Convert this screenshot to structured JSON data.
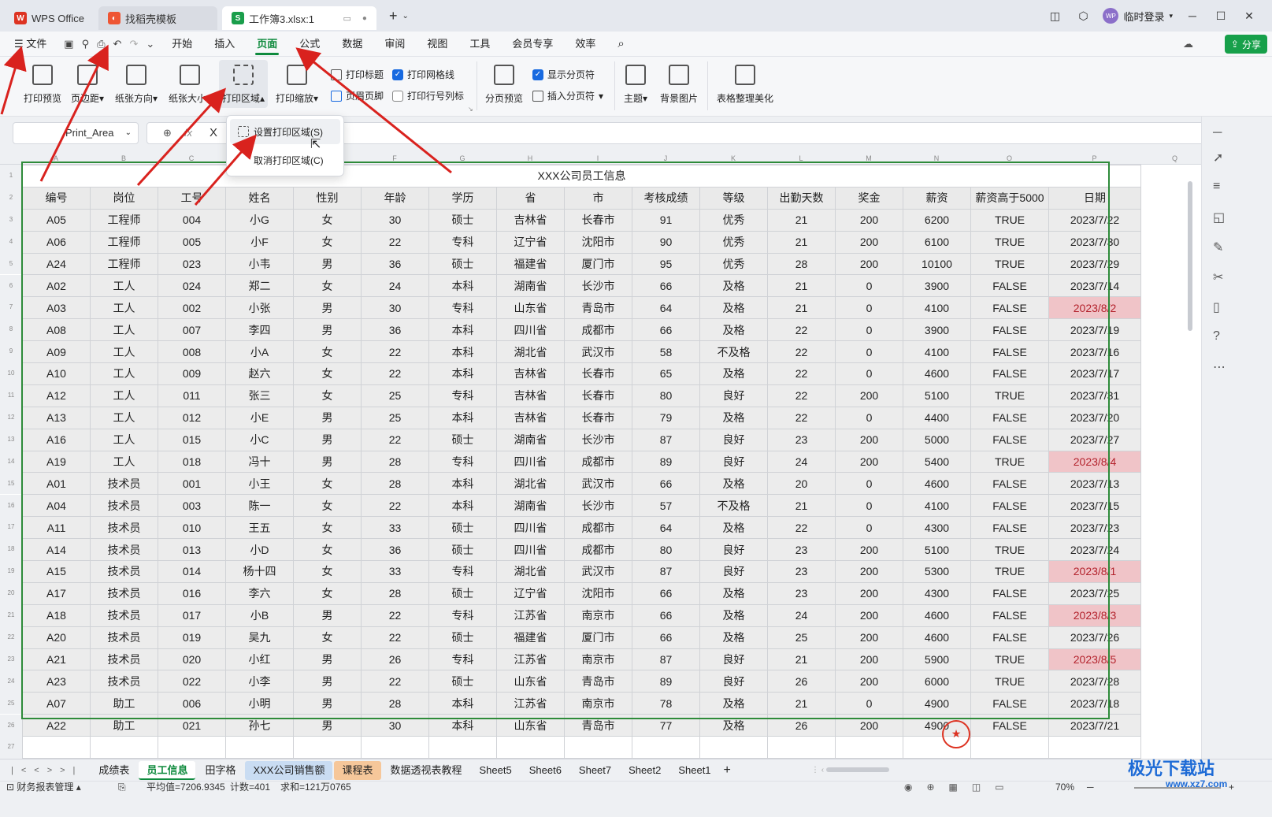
{
  "titlebar": {
    "tabs": [
      {
        "label": "WPS Office",
        "icon": "wps-logo-icon"
      },
      {
        "label": "找稻壳模板",
        "icon": "docer-icon"
      },
      {
        "label": "工作簿3.xlsx:1",
        "icon": "sheet-icon"
      }
    ],
    "user": "临时登录"
  },
  "menubar": {
    "file": "文件",
    "items": [
      "开始",
      "插入",
      "页面",
      "公式",
      "数据",
      "审阅",
      "视图",
      "工具",
      "会员专享",
      "效率"
    ],
    "active": "页面",
    "share": "分享"
  },
  "ribbon": {
    "print_preview": "打印预览",
    "margins": "页边距",
    "orientation": "纸张方向",
    "paper_size": "纸张大小",
    "print_area": "打印区域",
    "print_scale": "打印缩放",
    "print_titles": "打印标题",
    "header_footer": "页眉页脚",
    "print_gridlines": "打印网格线",
    "print_row_col": "打印行号列标",
    "page_break_preview": "分页预览",
    "show_page_breaks": "显示分页符",
    "insert_page_break": "插入分页符",
    "theme": "主题",
    "background": "背景图片",
    "beautify": "表格整理美化"
  },
  "formula": {
    "namebox": "Print_Area",
    "fx": "fx",
    "content": "X"
  },
  "dropdown": {
    "set": "设置打印区域(S)",
    "cancel": "取消打印区域(C)"
  },
  "columns": [
    "A",
    "B",
    "C",
    "D",
    "E",
    "F",
    "G",
    "H",
    "I",
    "J",
    "K",
    "L",
    "M",
    "N",
    "O",
    "P",
    "Q"
  ],
  "sheet": {
    "title": "XXX公司员工信息",
    "headers": [
      "编号",
      "岗位",
      "工号",
      "姓名",
      "性别",
      "年龄",
      "学历",
      "省",
      "市",
      "考核成绩",
      "等级",
      "出勤天数",
      "奖金",
      "薪资",
      "薪资高于5000",
      "日期"
    ],
    "rows": [
      [
        "A05",
        "工程师",
        "004",
        "小G",
        "女",
        "30",
        "硕士",
        "吉林省",
        "长春市",
        "91",
        "优秀",
        "21",
        "200",
        "6200",
        "TRUE",
        "2023/7/22"
      ],
      [
        "A06",
        "工程师",
        "005",
        "小F",
        "女",
        "22",
        "专科",
        "辽宁省",
        "沈阳市",
        "90",
        "优秀",
        "21",
        "200",
        "6100",
        "TRUE",
        "2023/7/30"
      ],
      [
        "A24",
        "工程师",
        "023",
        "小韦",
        "男",
        "36",
        "硕士",
        "福建省",
        "厦门市",
        "95",
        "优秀",
        "28",
        "200",
        "10100",
        "TRUE",
        "2023/7/29"
      ],
      [
        "A02",
        "工人",
        "024",
        "郑二",
        "女",
        "24",
        "本科",
        "湖南省",
        "长沙市",
        "66",
        "及格",
        "21",
        "0",
        "3900",
        "FALSE",
        "2023/7/14"
      ],
      [
        "A03",
        "工人",
        "002",
        "小张",
        "男",
        "30",
        "专科",
        "山东省",
        "青岛市",
        "64",
        "及格",
        "21",
        "0",
        "4100",
        "FALSE",
        "2023/8/2"
      ],
      [
        "A08",
        "工人",
        "007",
        "李四",
        "男",
        "36",
        "本科",
        "四川省",
        "成都市",
        "66",
        "及格",
        "22",
        "0",
        "3900",
        "FALSE",
        "2023/7/19"
      ],
      [
        "A09",
        "工人",
        "008",
        "小A",
        "女",
        "22",
        "本科",
        "湖北省",
        "武汉市",
        "58",
        "不及格",
        "22",
        "0",
        "4100",
        "FALSE",
        "2023/7/16"
      ],
      [
        "A10",
        "工人",
        "009",
        "赵六",
        "女",
        "22",
        "本科",
        "吉林省",
        "长春市",
        "65",
        "及格",
        "22",
        "0",
        "4600",
        "FALSE",
        "2023/7/17"
      ],
      [
        "A12",
        "工人",
        "011",
        "张三",
        "女",
        "25",
        "专科",
        "吉林省",
        "长春市",
        "80",
        "良好",
        "22",
        "200",
        "5100",
        "TRUE",
        "2023/7/31"
      ],
      [
        "A13",
        "工人",
        "012",
        "小E",
        "男",
        "25",
        "本科",
        "吉林省",
        "长春市",
        "79",
        "及格",
        "22",
        "0",
        "4400",
        "FALSE",
        "2023/7/20"
      ],
      [
        "A16",
        "工人",
        "015",
        "小C",
        "男",
        "22",
        "硕士",
        "湖南省",
        "长沙市",
        "87",
        "良好",
        "23",
        "200",
        "5000",
        "FALSE",
        "2023/7/27"
      ],
      [
        "A19",
        "工人",
        "018",
        "冯十",
        "男",
        "28",
        "专科",
        "四川省",
        "成都市",
        "89",
        "良好",
        "24",
        "200",
        "5400",
        "TRUE",
        "2023/8/4"
      ],
      [
        "A01",
        "技术员",
        "001",
        "小王",
        "女",
        "28",
        "本科",
        "湖北省",
        "武汉市",
        "66",
        "及格",
        "20",
        "0",
        "4600",
        "FALSE",
        "2023/7/13"
      ],
      [
        "A04",
        "技术员",
        "003",
        "陈一",
        "女",
        "22",
        "本科",
        "湖南省",
        "长沙市",
        "57",
        "不及格",
        "21",
        "0",
        "4100",
        "FALSE",
        "2023/7/15"
      ],
      [
        "A11",
        "技术员",
        "010",
        "王五",
        "女",
        "33",
        "硕士",
        "四川省",
        "成都市",
        "64",
        "及格",
        "22",
        "0",
        "4300",
        "FALSE",
        "2023/7/23"
      ],
      [
        "A14",
        "技术员",
        "013",
        "小D",
        "女",
        "36",
        "硕士",
        "四川省",
        "成都市",
        "80",
        "良好",
        "23",
        "200",
        "5100",
        "TRUE",
        "2023/7/24"
      ],
      [
        "A15",
        "技术员",
        "014",
        "杨十四",
        "女",
        "33",
        "专科",
        "湖北省",
        "武汉市",
        "87",
        "良好",
        "23",
        "200",
        "5300",
        "TRUE",
        "2023/8/1"
      ],
      [
        "A17",
        "技术员",
        "016",
        "李六",
        "女",
        "28",
        "硕士",
        "辽宁省",
        "沈阳市",
        "66",
        "及格",
        "23",
        "200",
        "4300",
        "FALSE",
        "2023/7/25"
      ],
      [
        "A18",
        "技术员",
        "017",
        "小B",
        "男",
        "22",
        "专科",
        "江苏省",
        "南京市",
        "66",
        "及格",
        "24",
        "200",
        "4600",
        "FALSE",
        "2023/8/3"
      ],
      [
        "A20",
        "技术员",
        "019",
        "吴九",
        "女",
        "22",
        "硕士",
        "福建省",
        "厦门市",
        "66",
        "及格",
        "25",
        "200",
        "4600",
        "FALSE",
        "2023/7/26"
      ],
      [
        "A21",
        "技术员",
        "020",
        "小红",
        "男",
        "26",
        "专科",
        "江苏省",
        "南京市",
        "87",
        "良好",
        "21",
        "200",
        "5900",
        "TRUE",
        "2023/8/5"
      ],
      [
        "A23",
        "技术员",
        "022",
        "小李",
        "男",
        "22",
        "硕士",
        "山东省",
        "青岛市",
        "89",
        "良好",
        "26",
        "200",
        "6000",
        "TRUE",
        "2023/7/28"
      ],
      [
        "A07",
        "助工",
        "006",
        "小明",
        "男",
        "28",
        "本科",
        "江苏省",
        "南京市",
        "78",
        "及格",
        "21",
        "0",
        "4900",
        "FALSE",
        "2023/7/18"
      ],
      [
        "A22",
        "助工",
        "021",
        "孙七",
        "男",
        "30",
        "本科",
        "山东省",
        "青岛市",
        "77",
        "及格",
        "26",
        "200",
        "4900",
        "FALSE",
        "2023/7/21"
      ]
    ],
    "highlight_dates": [
      "2023/8/2",
      "2023/8/4",
      "2023/8/1",
      "2023/8/3",
      "2023/8/5"
    ]
  },
  "sheet_tabs": [
    "成绩表",
    "员工信息",
    "田字格",
    "XXX公司销售额",
    "课程表",
    "数据透视表教程",
    "Sheet5",
    "Sheet6",
    "Sheet7",
    "Sheet2",
    "Sheet1"
  ],
  "active_sheet": "员工信息",
  "status": {
    "doc": "财务报表管理",
    "avg": "平均值=7206.9345",
    "count": "计数=401",
    "sum": "求和=121万0765",
    "zoom": "70%"
  },
  "watermark": {
    "main": "极光下载站",
    "url": "www.xz7.com"
  },
  "colors": {
    "accent": "#0e8a3d",
    "print_area_border": "#2e8b3a",
    "arrow": "#d9221e",
    "pink": "#f0c4c8"
  }
}
